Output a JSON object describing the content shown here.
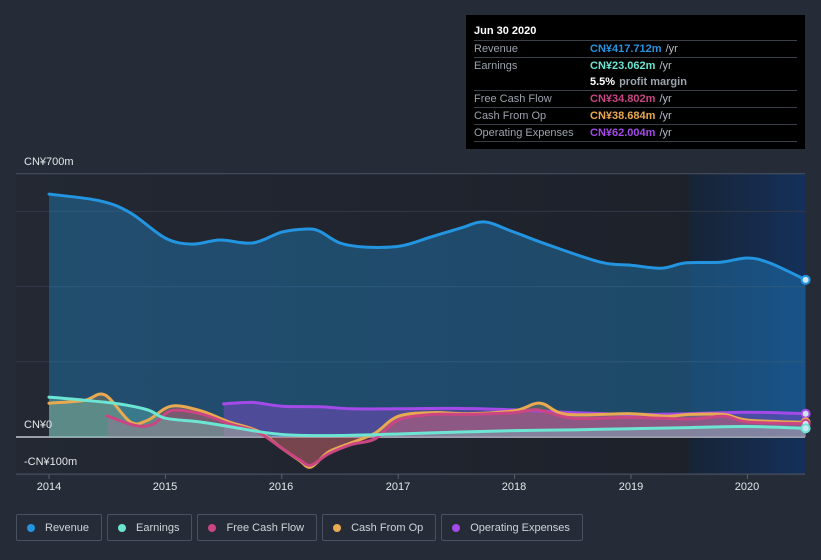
{
  "tooltip": {
    "date": "Jun 30 2020",
    "rows": [
      {
        "label": "Revenue",
        "value": "CN¥417.712m",
        "unit": "/yr",
        "color": "#2394df"
      },
      {
        "label": "Earnings",
        "value": "CN¥23.062m",
        "unit": "/yr",
        "color": "#6ce5d3"
      },
      {
        "label": "Free Cash Flow",
        "value": "CN¥34.802m",
        "unit": "/yr",
        "color": "#c94583"
      },
      {
        "label": "Cash From Op",
        "value": "CN¥38.684m",
        "unit": "/yr",
        "color": "#e9a951"
      },
      {
        "label": "Operating Expenses",
        "value": "CN¥62.004m",
        "unit": "/yr",
        "color": "#a44ae8"
      }
    ],
    "profit_margin_pct": "5.5%",
    "profit_margin_label": "profit margin"
  },
  "chart_data": {
    "type": "area",
    "title": "",
    "xlabel": "",
    "ylabel": "",
    "ylim": [
      -100,
      700
    ],
    "xlim": [
      2013.99,
      2020.5
    ],
    "y_tick_labels": [
      {
        "value": 700,
        "label": "CN¥700m"
      },
      {
        "value": 0,
        "label": "CN¥0"
      },
      {
        "value": -100,
        "label": "-CN¥100m"
      }
    ],
    "x_tick_labels": [
      "2014",
      "2015",
      "2016",
      "2017",
      "2018",
      "2019",
      "2020"
    ],
    "x_tick_values": [
      2014,
      2015,
      2016,
      2017,
      2018,
      2019,
      2020
    ],
    "gridlines": [
      600,
      400,
      200,
      0,
      -100
    ],
    "highlight_range": [
      2019.5,
      2020.5
    ],
    "series": [
      {
        "name": "Revenue",
        "color": "#2394df",
        "x": [
          2014.0,
          2014.44,
          2014.7,
          2015.0,
          2015.23,
          2015.47,
          2015.75,
          2016.0,
          2016.2,
          2016.32,
          2016.5,
          2016.72,
          2017.02,
          2017.28,
          2017.54,
          2017.74,
          2017.97,
          2018.27,
          2018.74,
          2019.0,
          2019.26,
          2019.47,
          2019.77,
          2020.0,
          2020.19,
          2020.5
        ],
        "values": [
          646,
          628,
          596,
          529,
          513,
          524,
          516,
          545,
          553,
          548,
          516,
          505,
          508,
          532,
          556,
          572,
          548,
          513,
          465,
          457,
          449,
          463,
          465,
          476,
          463,
          418
        ]
      },
      {
        "name": "Earnings",
        "color": "#6ce5d3",
        "x": [
          2014.0,
          2014.3,
          2014.6,
          2014.85,
          2015.0,
          2015.3,
          2015.6,
          2015.85,
          2016.1,
          2016.5,
          2017.0,
          2017.5,
          2018.0,
          2018.5,
          2019.0,
          2019.5,
          2020.0,
          2020.5
        ],
        "values": [
          106,
          98,
          88,
          72,
          50,
          40,
          25,
          12,
          5,
          4,
          8,
          13,
          17,
          19,
          22,
          25,
          28,
          23
        ]
      },
      {
        "name": "Free Cash Flow",
        "color": "#c94583",
        "x": [
          2014.5,
          2014.75,
          2014.9,
          2015.05,
          2015.3,
          2015.55,
          2015.8,
          2016.0,
          2016.15,
          2016.25,
          2016.4,
          2016.6,
          2016.8,
          2017.0,
          2017.3,
          2017.6,
          2018.0,
          2018.2,
          2018.5,
          2019.0,
          2019.5,
          2019.8,
          2020.0,
          2020.5
        ],
        "values": [
          56,
          30,
          35,
          70,
          62,
          35,
          12,
          -30,
          -60,
          -75,
          -45,
          -20,
          -5,
          45,
          60,
          60,
          65,
          72,
          50,
          52,
          48,
          55,
          40,
          35
        ]
      },
      {
        "name": "Cash From Op",
        "color": "#e9a951",
        "x": [
          2014.0,
          2014.3,
          2014.48,
          2014.7,
          2014.85,
          2015.05,
          2015.3,
          2015.55,
          2015.8,
          2016.0,
          2016.15,
          2016.25,
          2016.4,
          2016.6,
          2016.8,
          2017.0,
          2017.3,
          2017.6,
          2018.0,
          2018.22,
          2018.45,
          2019.0,
          2019.3,
          2019.5,
          2019.8,
          2020.0,
          2020.5
        ],
        "values": [
          90,
          97,
          112,
          40,
          45,
          82,
          70,
          40,
          15,
          -30,
          -62,
          -80,
          -40,
          -15,
          10,
          55,
          65,
          62,
          70,
          90,
          60,
          62,
          55,
          60,
          60,
          45,
          39
        ]
      },
      {
        "name": "Operating Expenses",
        "color": "#a44ae8",
        "x": [
          2015.5,
          2015.75,
          2016.0,
          2016.35,
          2016.6,
          2017.0,
          2017.5,
          2018.0,
          2018.5,
          2019.0,
          2019.5,
          2020.0,
          2020.5
        ],
        "values": [
          88,
          92,
          82,
          80,
          75,
          75,
          76,
          72,
          65,
          60,
          62,
          66,
          62
        ]
      }
    ],
    "legend": {
      "position": "bottom-left",
      "entries": [
        "Revenue",
        "Earnings",
        "Free Cash Flow",
        "Cash From Op",
        "Operating Expenses"
      ]
    }
  }
}
